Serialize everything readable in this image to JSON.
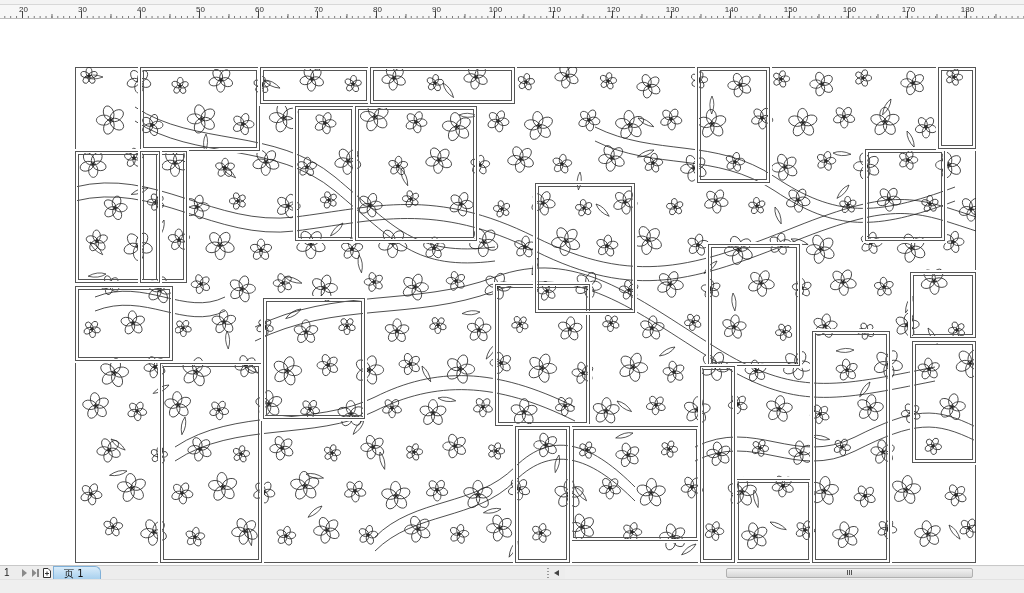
{
  "ruler": {
    "labels": [
      "20",
      "30",
      "40",
      "50",
      "60",
      "70",
      "80",
      "90",
      "100",
      "110",
      "120",
      "130",
      "140",
      "150",
      "160",
      "170",
      "180"
    ]
  },
  "page_navigator": {
    "page_number": "1",
    "tabs": [
      {
        "label": "页 1",
        "selected": true
      }
    ]
  }
}
